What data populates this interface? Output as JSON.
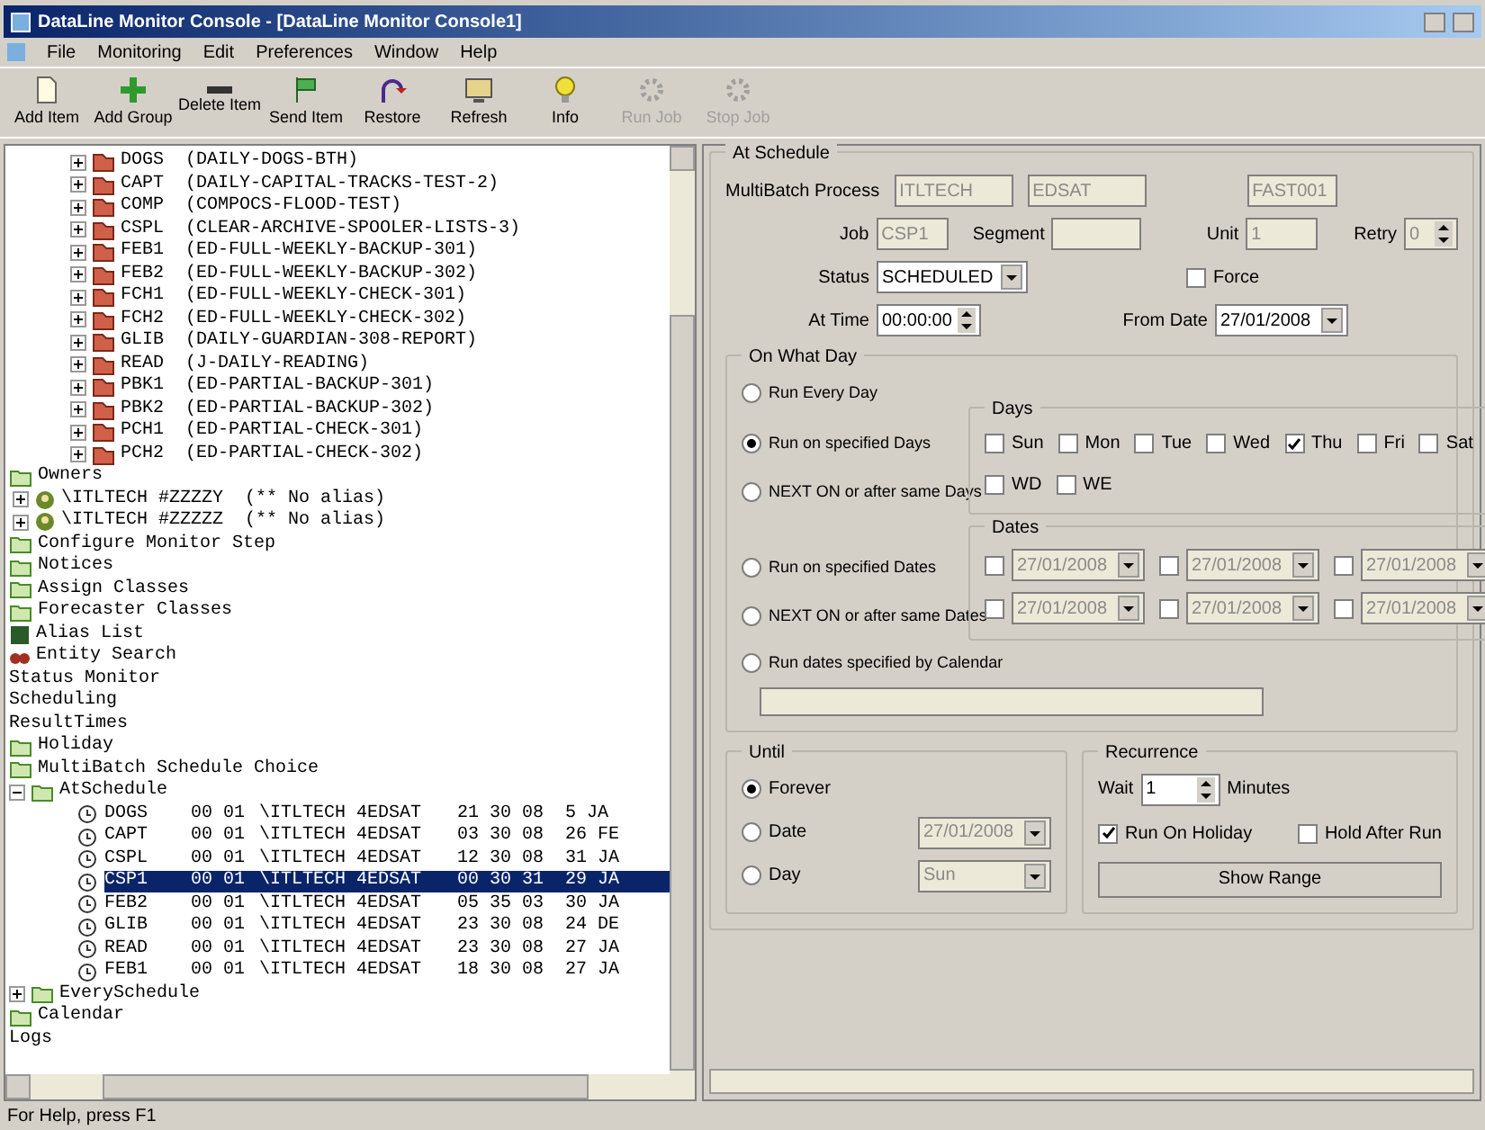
{
  "window": {
    "title": "DataLine Monitor Console - [DataLine Monitor Console1]"
  },
  "menu": [
    "File",
    "Monitoring",
    "Edit",
    "Preferences",
    "Window",
    "Help"
  ],
  "toolbar": [
    {
      "label": "Add Item",
      "kind": "page",
      "disabled": false
    },
    {
      "label": "Add Group",
      "kind": "plus",
      "disabled": false
    },
    {
      "label": "Delete Item",
      "kind": "minus",
      "disabled": false
    },
    {
      "label": "Send Item",
      "kind": "flag",
      "disabled": false
    },
    {
      "label": "Restore",
      "kind": "arrow",
      "disabled": false
    },
    {
      "label": "Refresh",
      "kind": "screen",
      "disabled": false
    },
    {
      "label": "Info",
      "kind": "bulb",
      "disabled": false
    },
    {
      "label": "Run Job",
      "kind": "gear",
      "disabled": true
    },
    {
      "label": "Stop Job",
      "kind": "gear",
      "disabled": true
    }
  ],
  "tree": [
    {
      "kind": "job",
      "label": "DOGS  (DAILY-DOGS-BTH)",
      "expanded": false
    },
    {
      "kind": "job",
      "label": "CAPT  (DAILY-CAPITAL-TRACKS-TEST-2)",
      "expanded": false
    },
    {
      "kind": "job",
      "label": "COMP  (COMPOCS-FLOOD-TEST)",
      "expanded": false
    },
    {
      "kind": "job",
      "label": "CSPL  (CLEAR-ARCHIVE-SPOOLER-LISTS-3)",
      "expanded": false
    },
    {
      "kind": "job",
      "label": "FEB1  (ED-FULL-WEEKLY-BACKUP-301)",
      "expanded": false
    },
    {
      "kind": "job",
      "label": "FEB2  (ED-FULL-WEEKLY-BACKUP-302)",
      "expanded": false
    },
    {
      "kind": "job",
      "label": "FCH1  (ED-FULL-WEEKLY-CHECK-301)",
      "expanded": false
    },
    {
      "kind": "job",
      "label": "FCH2  (ED-FULL-WEEKLY-CHECK-302)",
      "expanded": false
    },
    {
      "kind": "job",
      "label": "GLIB  (DAILY-GUARDIAN-308-REPORT)",
      "expanded": false
    },
    {
      "kind": "job",
      "label": "READ  (J-DAILY-READING)",
      "expanded": false
    },
    {
      "kind": "job",
      "label": "PBK1  (ED-PARTIAL-BACKUP-301)",
      "expanded": false
    },
    {
      "kind": "job",
      "label": "PBK2  (ED-PARTIAL-BACKUP-302)",
      "expanded": false
    },
    {
      "kind": "job",
      "label": "PCH1  (ED-PARTIAL-CHECK-301)",
      "expanded": false
    },
    {
      "kind": "job",
      "label": "PCH2  (ED-PARTIAL-CHECK-302)",
      "expanded": false
    },
    {
      "kind": "folder",
      "label": "Owners"
    },
    {
      "kind": "alias",
      "label": "\\ITLTECH #ZZZZY  (** No alias)",
      "expanded": false
    },
    {
      "kind": "alias",
      "label": "\\ITLTECH #ZZZZZ  (** No alias)",
      "expanded": false
    },
    {
      "kind": "folder",
      "label": "Configure Monitor Step"
    },
    {
      "kind": "folder",
      "label": "Notices"
    },
    {
      "kind": "folder",
      "label": "Assign Classes"
    },
    {
      "kind": "folder",
      "label": "Forecaster Classes"
    },
    {
      "kind": "book",
      "label": "Alias List"
    },
    {
      "kind": "search",
      "label": "Entity Search"
    },
    {
      "kind": "plain",
      "label": "Status Monitor"
    },
    {
      "kind": "plain",
      "label": "Scheduling"
    },
    {
      "kind": "plain",
      "label": "ResultTimes"
    },
    {
      "kind": "folder",
      "label": "Holiday"
    },
    {
      "kind": "folder",
      "label": "MultiBatch Schedule Choice"
    },
    {
      "kind": "folder",
      "label": "AtSchedule",
      "expanded": true,
      "children": [
        {
          "kind": "schedule",
          "cells": [
            "DOGS",
            "00 01",
            "\\ITLTECH 4EDSAT",
            "21 30 08",
            "5 JA"
          ],
          "selected": false
        },
        {
          "kind": "schedule",
          "cells": [
            "CAPT",
            "00 01",
            "\\ITLTECH 4EDSAT",
            "03 30 08",
            "26 FE"
          ],
          "selected": false
        },
        {
          "kind": "schedule",
          "cells": [
            "CSPL",
            "00 01",
            "\\ITLTECH 4EDSAT",
            "12 30 08",
            "31 JA"
          ],
          "selected": false
        },
        {
          "kind": "schedule",
          "cells": [
            "CSP1",
            "00 01",
            "\\ITLTECH 4EDSAT",
            "00 30 31",
            "29 JA"
          ],
          "selected": true
        },
        {
          "kind": "schedule",
          "cells": [
            "FEB2",
            "00 01",
            "\\ITLTECH 4EDSAT",
            "05 35 03",
            "30 JA"
          ],
          "selected": false
        },
        {
          "kind": "schedule",
          "cells": [
            "GLIB",
            "00 01",
            "\\ITLTECH 4EDSAT",
            "23 30 08",
            "24 DE"
          ],
          "selected": false
        },
        {
          "kind": "schedule",
          "cells": [
            "READ",
            "00 01",
            "\\ITLTECH 4EDSAT",
            "23 30 08",
            "27 JA"
          ],
          "selected": false
        },
        {
          "kind": "schedule",
          "cells": [
            "FEB1",
            "00 01",
            "\\ITLTECH 4EDSAT",
            "18 30 08",
            "27 JA"
          ],
          "selected": false
        }
      ]
    },
    {
      "kind": "folder",
      "label": "EverySchedule",
      "expanded": false
    },
    {
      "kind": "folder",
      "label": "Calendar"
    },
    {
      "kind": "plain",
      "label": "Logs"
    }
  ],
  "form": {
    "title": "At Schedule",
    "process_label": "MultiBatch Process",
    "process_values": [
      "ITLTECH",
      "EDSAT",
      "FAST001"
    ],
    "job_label": "Job",
    "job": "CSP1",
    "segment_label": "Segment",
    "unit_label": "Unit",
    "unit": "1",
    "retry_label": "Retry",
    "retry": "0",
    "status_label": "Status",
    "status": "SCHEDULED",
    "force": {
      "label": "Force",
      "checked": false
    },
    "at_time_label": "At Time",
    "at_time": "00:00:00",
    "from_date_label": "From Date",
    "from_date": "27/01/2008",
    "on_what_day": {
      "title": "On What Day",
      "options": [
        {
          "label": "Run Every Day",
          "selected": false
        },
        {
          "label": "Run on specified Days",
          "selected": true
        },
        {
          "label": "NEXT ON or after same Days",
          "selected": false
        },
        {
          "label": "Run on specified Dates",
          "selected": false
        },
        {
          "label": "NEXT ON or after same Dates",
          "selected": false
        },
        {
          "label": "Run dates specified by Calendar",
          "selected": false
        }
      ],
      "days_title": "Days",
      "days": [
        {
          "label": "Sun",
          "checked": false
        },
        {
          "label": "Mon",
          "checked": false
        },
        {
          "label": "Tue",
          "checked": false
        },
        {
          "label": "Wed",
          "checked": false
        },
        {
          "label": "Thu",
          "checked": true
        },
        {
          "label": "Fri",
          "checked": false
        },
        {
          "label": "Sat",
          "checked": false
        }
      ],
      "day_types": [
        {
          "label": "WD",
          "checked": false
        },
        {
          "label": "WE",
          "checked": false
        }
      ],
      "dates_title": "Dates",
      "dates": [
        {
          "value": "27/01/2008",
          "checked": false
        },
        {
          "value": "27/01/2008",
          "checked": false
        },
        {
          "value": "27/01/2008",
          "checked": false
        },
        {
          "value": "27/01/2008",
          "checked": false
        },
        {
          "value": "27/01/2008",
          "checked": false
        },
        {
          "value": "27/01/2008",
          "checked": false
        }
      ]
    },
    "until": {
      "title": "Until",
      "options": [
        {
          "label": "Forever",
          "selected": true
        },
        {
          "label": "Date",
          "selected": false,
          "value": "27/01/2008"
        },
        {
          "label": "Day",
          "selected": false,
          "value": "Sun"
        }
      ]
    },
    "recurrence": {
      "title": "Recurrence",
      "wait_label": "Wait",
      "wait": "1",
      "minutes_label": "Minutes",
      "run_on_holiday": {
        "label": "Run On Holiday",
        "checked": true
      },
      "hold_after_run": {
        "label": "Hold After Run",
        "checked": false
      },
      "button": "Show Range"
    }
  },
  "status_bar": "For Help, press F1"
}
